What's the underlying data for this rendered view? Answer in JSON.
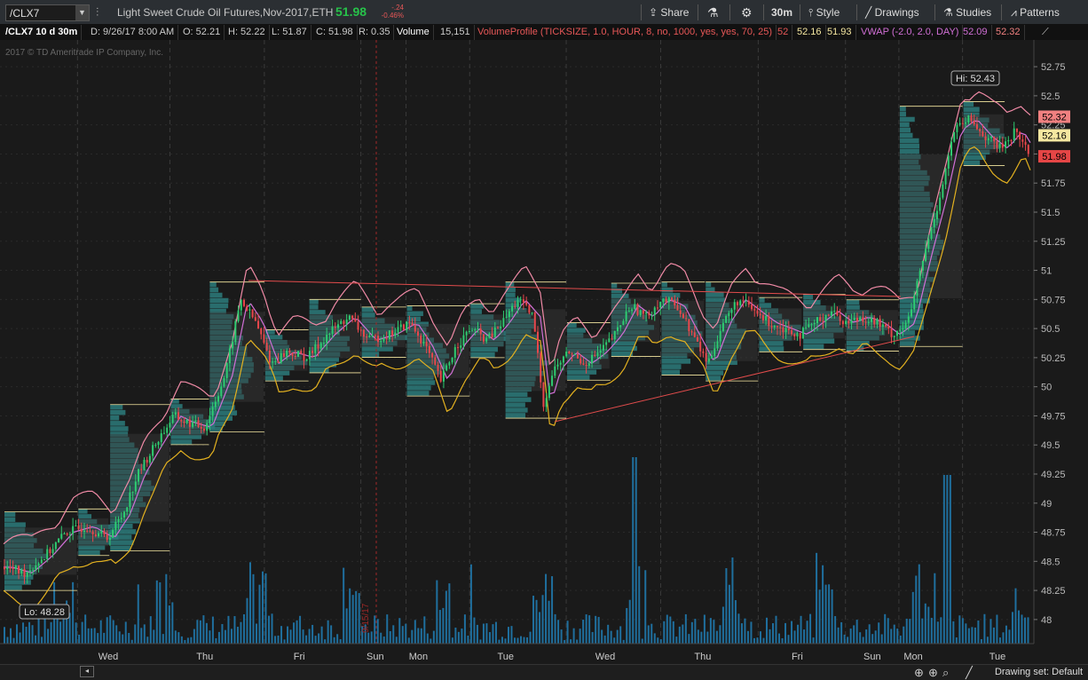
{
  "toolbar": {
    "symbol": "/CLX7",
    "description": "Light Sweet Crude Oil Futures,Nov-2017,ETH",
    "last_price": "51.98",
    "change": "-.24",
    "change_pct": "-0.46%",
    "share_label": "Share",
    "timeframe": "30m",
    "style_label": "Style",
    "drawings_label": "Drawings",
    "studies_label": "Studies",
    "patterns_label": "Patterns"
  },
  "infobar": {
    "title": "/CLX7 10 d 30m",
    "date": "D: 9/26/17 8:00 AM",
    "open": "O: 52.21",
    "high": "H: 52.22",
    "low": "L: 51.87",
    "close": "C: 51.98",
    "range": "R: 0.35",
    "volume_label": "Volume",
    "volume_value": "15,151",
    "vp_study": "VolumeProfile (TICKSIZE, 1.0, HOUR, 8, no, 1000, yes, yes, 70, 25)",
    "vp_v1": "52",
    "vp_v2": "52.16",
    "vp_v3": "51.93",
    "vwap_study": "VWAP (-2.0, 2.0, DAY)",
    "vwap_v1": "52.09",
    "vwap_v2": "52.32"
  },
  "watermark": "2017 © TD Ameritrade IP Company, Inc.",
  "chart": {
    "hi_label": "Hi: 52.43",
    "lo_label": "Lo: 48.28",
    "date_marker": "9/15/17",
    "price_tags": [
      {
        "value": "52.32",
        "color": "#f08080"
      },
      {
        "value": "52.16",
        "color": "#f5e7a0"
      },
      {
        "value": "51.98",
        "color": "#e64646"
      }
    ],
    "colors": {
      "up": "#2ecc71",
      "down": "#e8474c",
      "vwap": "#d16fd6",
      "upper_band": "#f08aa6",
      "lower_band": "#e3b120",
      "profile": "#2d7c7c",
      "volume": "#1f6f9e",
      "trendline": "#e24c4c"
    }
  },
  "chart_data": {
    "type": "candlestick",
    "symbol": "/CLX7",
    "ylim": [
      47.9,
      52.85
    ],
    "y_ticks": [
      "52.75",
      "52.5",
      "52.25",
      "52",
      "51.75",
      "51.5",
      "51.25",
      "51",
      "50.75",
      "50.5",
      "50.25",
      "50",
      "49.75",
      "49.5",
      "49.25",
      "49",
      "48.75",
      "48.5",
      "48.25",
      "48"
    ],
    "x_labels": [
      "Wed",
      "Thu",
      "Fri",
      "Sun",
      "Mon",
      "Tue",
      "Wed",
      "Thu",
      "Fri",
      "Sun",
      "Mon",
      "Tue"
    ],
    "x_positions": [
      0.102,
      0.196,
      0.288,
      0.362,
      0.404,
      0.489,
      0.586,
      0.681,
      0.773,
      0.846,
      0.886,
      0.968
    ],
    "close_path": [
      [
        0.0,
        48.45
      ],
      [
        0.02,
        48.4
      ],
      [
        0.04,
        48.55
      ],
      [
        0.06,
        48.75
      ],
      [
        0.08,
        48.8
      ],
      [
        0.1,
        48.7
      ],
      [
        0.115,
        48.9
      ],
      [
        0.13,
        49.25
      ],
      [
        0.15,
        49.55
      ],
      [
        0.165,
        49.75
      ],
      [
        0.175,
        49.7
      ],
      [
        0.195,
        49.65
      ],
      [
        0.215,
        50.1
      ],
      [
        0.23,
        50.75
      ],
      [
        0.245,
        50.55
      ],
      [
        0.26,
        50.2
      ],
      [
        0.275,
        50.3
      ],
      [
        0.295,
        50.25
      ],
      [
        0.315,
        50.45
      ],
      [
        0.335,
        50.6
      ],
      [
        0.355,
        50.4
      ],
      [
        0.375,
        50.45
      ],
      [
        0.395,
        50.55
      ],
      [
        0.41,
        50.35
      ],
      [
        0.425,
        50.05
      ],
      [
        0.44,
        50.35
      ],
      [
        0.455,
        50.5
      ],
      [
        0.47,
        50.4
      ],
      [
        0.485,
        50.55
      ],
      [
        0.5,
        50.75
      ],
      [
        0.515,
        50.6
      ],
      [
        0.525,
        49.85
      ],
      [
        0.535,
        50.15
      ],
      [
        0.55,
        50.3
      ],
      [
        0.565,
        50.2
      ],
      [
        0.58,
        50.3
      ],
      [
        0.595,
        50.45
      ],
      [
        0.61,
        50.7
      ],
      [
        0.625,
        50.6
      ],
      [
        0.64,
        50.75
      ],
      [
        0.655,
        50.7
      ],
      [
        0.67,
        50.45
      ],
      [
        0.685,
        50.2
      ],
      [
        0.7,
        50.55
      ],
      [
        0.715,
        50.75
      ],
      [
        0.73,
        50.65
      ],
      [
        0.745,
        50.55
      ],
      [
        0.76,
        50.5
      ],
      [
        0.775,
        50.45
      ],
      [
        0.79,
        50.55
      ],
      [
        0.805,
        50.65
      ],
      [
        0.82,
        50.55
      ],
      [
        0.835,
        50.6
      ],
      [
        0.85,
        50.55
      ],
      [
        0.865,
        50.45
      ],
      [
        0.88,
        50.55
      ],
      [
        0.895,
        51.1
      ],
      [
        0.91,
        51.6
      ],
      [
        0.925,
        52.2
      ],
      [
        0.94,
        52.3
      ],
      [
        0.955,
        52.15
      ],
      [
        0.97,
        52.05
      ],
      [
        0.985,
        52.2
      ],
      [
        1.0,
        51.98
      ]
    ]
  },
  "statusbar": {
    "drawing_set": "Drawing set: Default"
  }
}
